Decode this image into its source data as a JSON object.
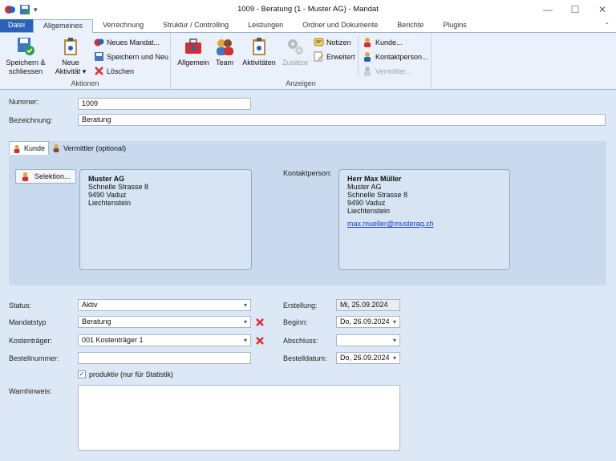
{
  "window": {
    "title": "1009 - Beratung (1 - Muster AG) - Mandat",
    "controls": [
      "minimize",
      "maximize",
      "close"
    ]
  },
  "ribbon": {
    "tabs": [
      "Datei",
      "Allgemeines",
      "Verrechnung",
      "Struktur / Controlling",
      "Leistungen",
      "Ordner und Dokumente",
      "Berichte",
      "Plugins"
    ],
    "active_tab": "Allgemeines",
    "groups": {
      "aktionen": {
        "label": "Aktionen",
        "save_close_line1": "Speichern &",
        "save_close_line2": "schliessen",
        "new_activity_line1": "Neue",
        "new_activity_line2": "Aktivität ▾",
        "new_mandate": "Neues Mandat...",
        "save_new": "Speichern und Neu",
        "delete": "Löschen"
      },
      "anzeigen": {
        "label": "Anzeigen",
        "general": "Allgemein",
        "team": "Team",
        "activities": "Aktivitäten",
        "extras": "Zusätze",
        "notes": "Notizen",
        "extended": "Erweitert",
        "customer": "Kunde...",
        "contact": "Kontaktperson...",
        "broker": "Vermittler..."
      }
    }
  },
  "form": {
    "nummer_label": "Nummer:",
    "nummer_value": "1009",
    "bezeichnung_label": "Bezeichnung:",
    "bezeichnung_value": "Beratung",
    "subtabs": [
      "Kunde",
      "Vermittler (optional)"
    ],
    "selection_button": "Selektion...",
    "customer_address": {
      "name": "Muster AG",
      "street": "Schnelle Strasse 8",
      "city": "9490 Vaduz",
      "country": "Liechtenstein"
    },
    "contact_label": "Kontaktperson:",
    "contact_address": {
      "name": "Herr Max Müller",
      "company": "Muster AG",
      "street": "Schnelle Strasse 8",
      "city": "9490 Vaduz",
      "country": "Liechtenstein",
      "email": "max.mueller@musterag.ch"
    },
    "status_label": "Status:",
    "status_value": "Aktiv",
    "mandatstyp_label": "Mandatstyp",
    "mandatstyp_value": "Beratung",
    "kostentraeger_label": "Kostenträger:",
    "kostentraeger_value": "001 Kostenträger 1",
    "bestellnummer_label": "Bestellnummer:",
    "bestellnummer_value": "",
    "erstellung_label": "Erstellung:",
    "erstellung_value": "Mi, 25.09.2024",
    "beginn_label": "Beginn:",
    "beginn_value": "Do, 26.09.2024",
    "abschluss_label": "Abschluss:",
    "abschluss_value": "",
    "bestelldatum_label": "Bestelldatum:",
    "bestelldatum_value": "Do, 26.09.2024",
    "produktiv_label": "produktiv (nur für Statistik)",
    "produktiv_checked": true,
    "warnhinweis_label": "Warnhinweis:",
    "warnhinweis_value": ""
  },
  "colors": {
    "ribbon_bg": "#eaf1fb",
    "form_bg": "#dce8f5",
    "file_tab": "#2b62b8",
    "delete_red": "#d33",
    "link": "#1a39d6"
  }
}
